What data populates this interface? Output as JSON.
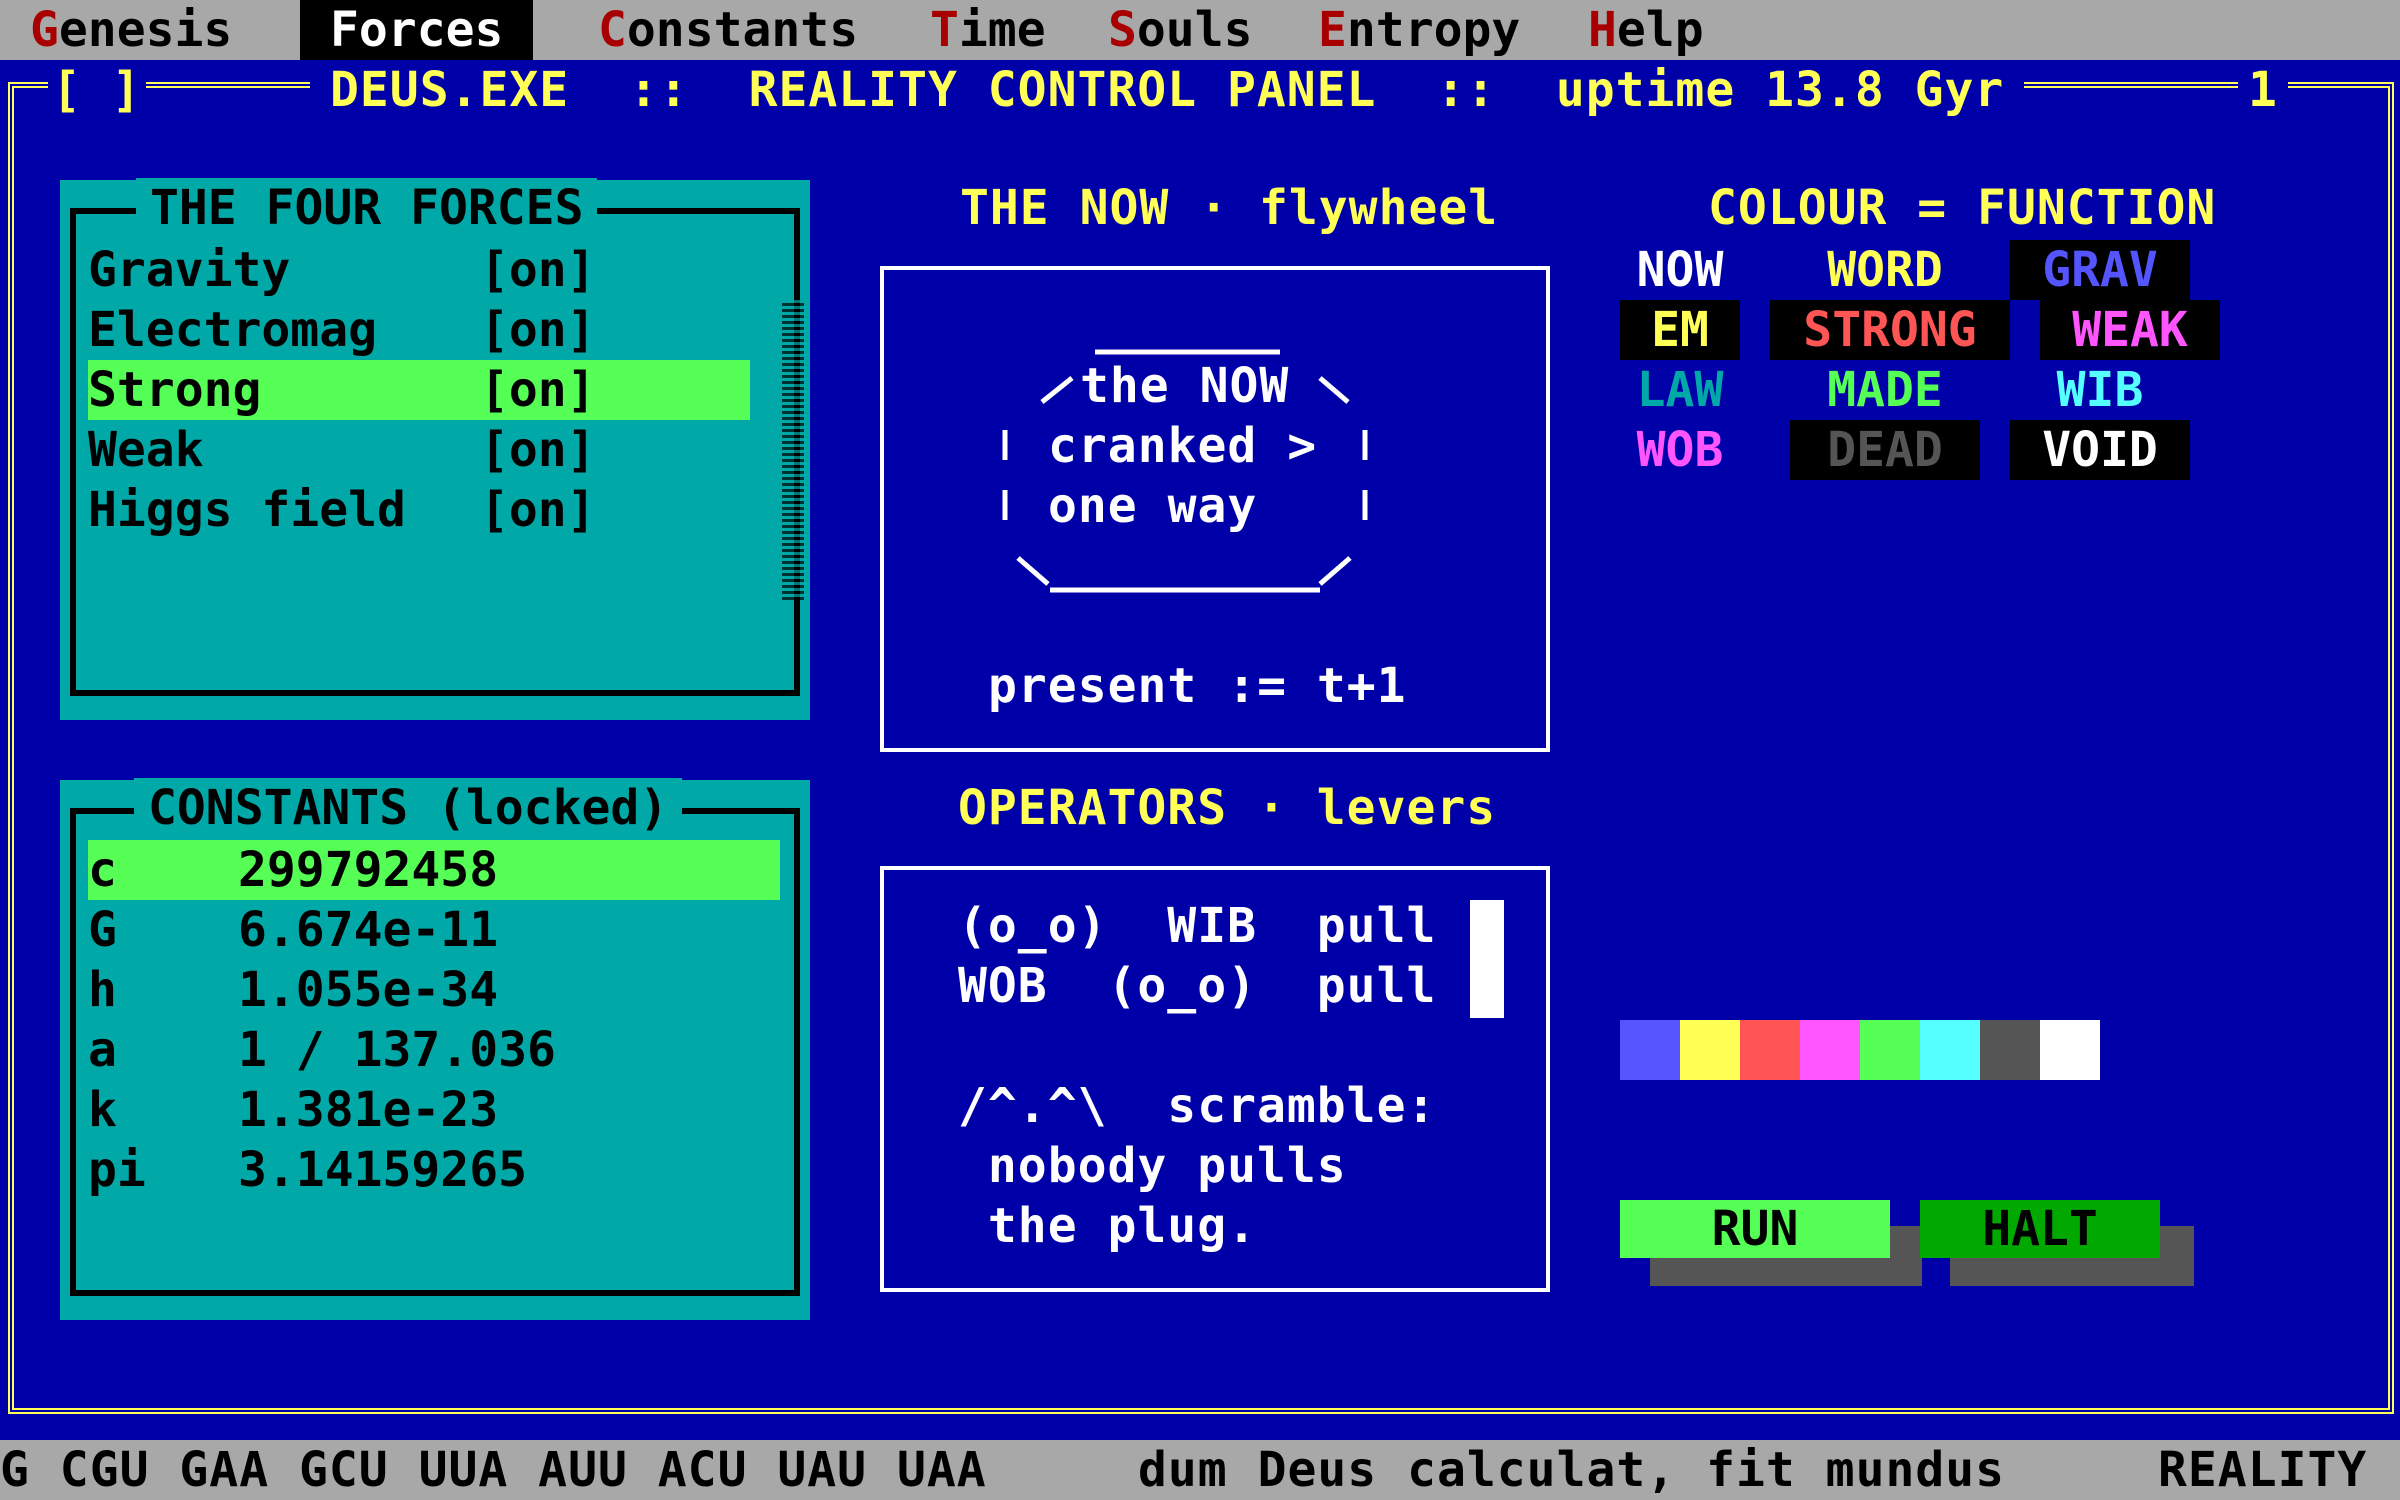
{
  "menu": {
    "items": [
      {
        "hot": "G",
        "rest": "enesis"
      },
      {
        "hot": "F",
        "rest": "orces"
      },
      {
        "hot": "C",
        "rest": "onstants"
      },
      {
        "hot": "T",
        "rest": "ime"
      },
      {
        "hot": "S",
        "rest": "ouls"
      },
      {
        "hot": "E",
        "rest": "ntropy"
      },
      {
        "hot": "H",
        "rest": "elp"
      }
    ],
    "active": "Forces"
  },
  "titlebar": {
    "close_box": "[ ]",
    "title": "DEUS.EXE  ::  REALITY CONTROL PANEL  ::  uptime 13.8 Gyr",
    "window_number": "1"
  },
  "forces_panel": {
    "title": "THE FOUR FORCES",
    "items": [
      {
        "name": "Gravity",
        "state": "[on]"
      },
      {
        "name": "Electromag",
        "state": "[on]"
      },
      {
        "name": "Strong",
        "state": "[on]"
      },
      {
        "name": "Weak",
        "state": "[on]"
      },
      {
        "name": "Higgs field",
        "state": "[on]"
      }
    ],
    "selected": "Strong"
  },
  "constants_panel": {
    "title": "CONSTANTS (locked)",
    "items": [
      {
        "symbol": "c",
        "value": "299792458"
      },
      {
        "symbol": "G",
        "value": "6.674e-11"
      },
      {
        "symbol": "h",
        "value": "1.055e-34"
      },
      {
        "symbol": "a",
        "value": "1 / 137.036"
      },
      {
        "symbol": "k",
        "value": "1.381e-23"
      },
      {
        "symbol": "pi",
        "value": "3.14159265"
      }
    ],
    "selected": "c"
  },
  "now_panel": {
    "heading": "THE NOW · flywheel",
    "wheel_lines": [
      "the NOW",
      "cranked >",
      "one way"
    ],
    "formula": "present := t+1"
  },
  "operators_panel": {
    "heading": "OPERATORS · levers",
    "lines": [
      "(o_o)  WIB  pull",
      "WOB  (o_o)  pull",
      "",
      "/^.^\\  scramble:",
      " nobody pulls",
      " the plug."
    ]
  },
  "legend": {
    "heading": "COLOUR = FUNCTION",
    "items": [
      {
        "label": "NOW",
        "color": "#ffffff",
        "bg": "none"
      },
      {
        "label": "WORD",
        "color": "#ffff55",
        "bg": "none"
      },
      {
        "label": "GRAV",
        "color": "#5555ff",
        "bg": "#000000"
      },
      {
        "label": "EM",
        "color": "#ffff55",
        "bg": "#000000"
      },
      {
        "label": "STRONG",
        "color": "#ff5555",
        "bg": "#000000"
      },
      {
        "label": "WEAK",
        "color": "#ff55ff",
        "bg": "#000000"
      },
      {
        "label": "LAW",
        "color": "#00a8a8",
        "bg": "none"
      },
      {
        "label": "MADE",
        "color": "#55ff55",
        "bg": "none"
      },
      {
        "label": "WIB",
        "color": "#55ffff",
        "bg": "none"
      },
      {
        "label": "WOB",
        "color": "#ff55ff",
        "bg": "none"
      },
      {
        "label": "DEAD",
        "color": "#555555",
        "bg": "#000000"
      },
      {
        "label": "VOID",
        "color": "#ffffff",
        "bg": "#000000"
      }
    ],
    "palette": [
      "#5555ff",
      "#ffff55",
      "#ff5555",
      "#ff55ff",
      "#55ff55",
      "#55ffff",
      "#555555",
      "#ffffff"
    ]
  },
  "buttons": {
    "run": "RUN",
    "halt": "HALT"
  },
  "statusbar": {
    "codons": "G CGU GAA GCU UUA AUU ACU UAU UAA",
    "motto": "dum Deus calculat, fit mundus",
    "mode": "REALITY"
  }
}
